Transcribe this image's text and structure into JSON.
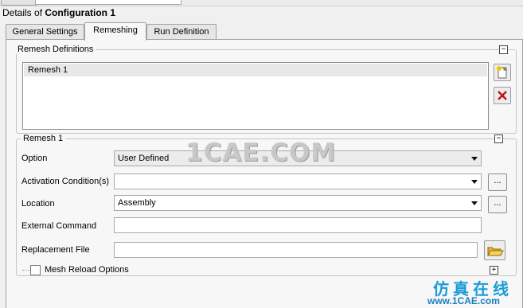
{
  "header": {
    "prefix": "Details of ",
    "title": "Configuration 1"
  },
  "tabs": [
    {
      "label": "General Settings"
    },
    {
      "label": "Remeshing"
    },
    {
      "label": "Run Definition"
    }
  ],
  "remesh_definitions": {
    "title": "Remesh Definitions",
    "items": [
      "Remesh 1"
    ]
  },
  "remesh_group": {
    "title": "Remesh 1",
    "option_label": "Option",
    "option_value": "User Defined",
    "activation_label": "Activation Condition(s)",
    "activation_value": "",
    "location_label": "Location",
    "location_value": "Assembly",
    "external_label": "External Command",
    "external_value": "",
    "replacement_label": "Replacement File",
    "replacement_value": "",
    "dots_label": "...",
    "mesh_reload_label": "Mesh Reload Options"
  },
  "watermark": {
    "main": "1CAE.COM",
    "cn": "仿真在线",
    "url": "www.1CAE.com"
  },
  "colors": {
    "accent": "#1a9cd8",
    "panel": "#f7f7f7"
  }
}
